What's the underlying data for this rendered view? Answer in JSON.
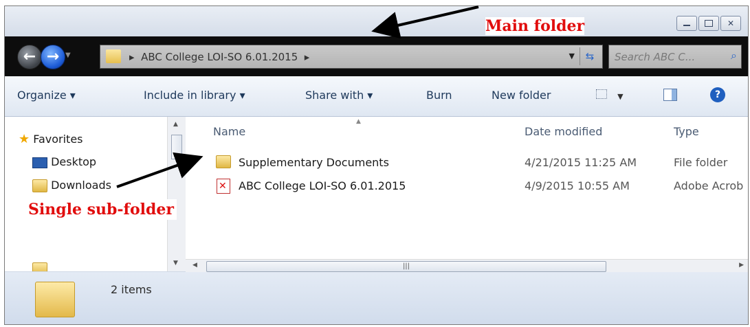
{
  "address": {
    "path": "ABC College LOI-SO 6.01.2015"
  },
  "search": {
    "placeholder": "Search ABC C..."
  },
  "toolbar": {
    "organize": "Organize ▾",
    "include_in_library": "Include in library ▾",
    "share_with": "Share with ▾",
    "burn": "Burn",
    "new_folder": "New folder"
  },
  "nav": {
    "favorites": "Favorites",
    "desktop": "Desktop",
    "downloads": "Downloads"
  },
  "columns": {
    "name": "Name",
    "date_modified": "Date modified",
    "type": "Type"
  },
  "files": [
    {
      "name": "Supplementary Documents",
      "date": "4/21/2015 11:25 AM",
      "type": "File folder"
    },
    {
      "name": "ABC College LOI-SO 6.01.2015",
      "date": "4/9/2015 10:55 AM",
      "type": "Adobe Acrob"
    }
  ],
  "details": {
    "count": "2 items"
  },
  "annotations": {
    "main": "Main folder",
    "sub": "Single sub-folder"
  },
  "colors": {
    "annotation": "#e10d0d",
    "addressbar": "#0d0d0d",
    "toolbar_text": "#1e395b"
  }
}
